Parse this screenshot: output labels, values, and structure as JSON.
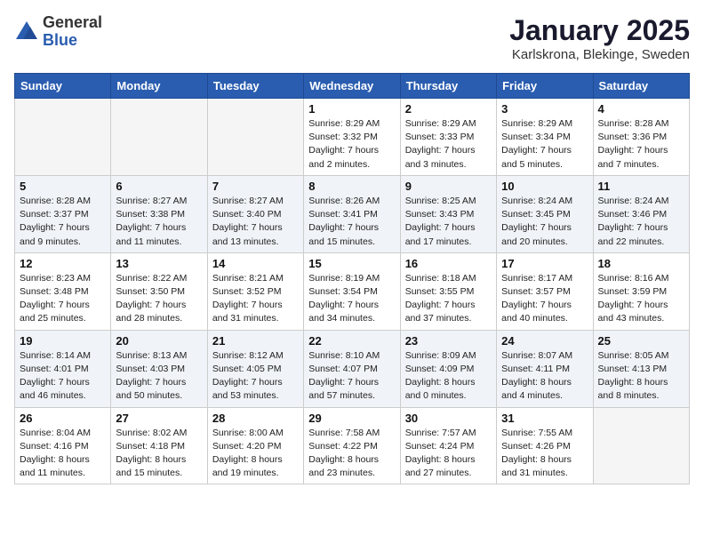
{
  "header": {
    "logo_general": "General",
    "logo_blue": "Blue",
    "title": "January 2025",
    "subtitle": "Karlskrona, Blekinge, Sweden"
  },
  "days_of_week": [
    "Sunday",
    "Monday",
    "Tuesday",
    "Wednesday",
    "Thursday",
    "Friday",
    "Saturday"
  ],
  "weeks": [
    {
      "shaded": false,
      "days": [
        {
          "num": "",
          "sunrise": "",
          "sunset": "",
          "daylight": ""
        },
        {
          "num": "",
          "sunrise": "",
          "sunset": "",
          "daylight": ""
        },
        {
          "num": "",
          "sunrise": "",
          "sunset": "",
          "daylight": ""
        },
        {
          "num": "1",
          "sunrise": "Sunrise: 8:29 AM",
          "sunset": "Sunset: 3:32 PM",
          "daylight": "Daylight: 7 hours and 2 minutes."
        },
        {
          "num": "2",
          "sunrise": "Sunrise: 8:29 AM",
          "sunset": "Sunset: 3:33 PM",
          "daylight": "Daylight: 7 hours and 3 minutes."
        },
        {
          "num": "3",
          "sunrise": "Sunrise: 8:29 AM",
          "sunset": "Sunset: 3:34 PM",
          "daylight": "Daylight: 7 hours and 5 minutes."
        },
        {
          "num": "4",
          "sunrise": "Sunrise: 8:28 AM",
          "sunset": "Sunset: 3:36 PM",
          "daylight": "Daylight: 7 hours and 7 minutes."
        }
      ]
    },
    {
      "shaded": true,
      "days": [
        {
          "num": "5",
          "sunrise": "Sunrise: 8:28 AM",
          "sunset": "Sunset: 3:37 PM",
          "daylight": "Daylight: 7 hours and 9 minutes."
        },
        {
          "num": "6",
          "sunrise": "Sunrise: 8:27 AM",
          "sunset": "Sunset: 3:38 PM",
          "daylight": "Daylight: 7 hours and 11 minutes."
        },
        {
          "num": "7",
          "sunrise": "Sunrise: 8:27 AM",
          "sunset": "Sunset: 3:40 PM",
          "daylight": "Daylight: 7 hours and 13 minutes."
        },
        {
          "num": "8",
          "sunrise": "Sunrise: 8:26 AM",
          "sunset": "Sunset: 3:41 PM",
          "daylight": "Daylight: 7 hours and 15 minutes."
        },
        {
          "num": "9",
          "sunrise": "Sunrise: 8:25 AM",
          "sunset": "Sunset: 3:43 PM",
          "daylight": "Daylight: 7 hours and 17 minutes."
        },
        {
          "num": "10",
          "sunrise": "Sunrise: 8:24 AM",
          "sunset": "Sunset: 3:45 PM",
          "daylight": "Daylight: 7 hours and 20 minutes."
        },
        {
          "num": "11",
          "sunrise": "Sunrise: 8:24 AM",
          "sunset": "Sunset: 3:46 PM",
          "daylight": "Daylight: 7 hours and 22 minutes."
        }
      ]
    },
    {
      "shaded": false,
      "days": [
        {
          "num": "12",
          "sunrise": "Sunrise: 8:23 AM",
          "sunset": "Sunset: 3:48 PM",
          "daylight": "Daylight: 7 hours and 25 minutes."
        },
        {
          "num": "13",
          "sunrise": "Sunrise: 8:22 AM",
          "sunset": "Sunset: 3:50 PM",
          "daylight": "Daylight: 7 hours and 28 minutes."
        },
        {
          "num": "14",
          "sunrise": "Sunrise: 8:21 AM",
          "sunset": "Sunset: 3:52 PM",
          "daylight": "Daylight: 7 hours and 31 minutes."
        },
        {
          "num": "15",
          "sunrise": "Sunrise: 8:19 AM",
          "sunset": "Sunset: 3:54 PM",
          "daylight": "Daylight: 7 hours and 34 minutes."
        },
        {
          "num": "16",
          "sunrise": "Sunrise: 8:18 AM",
          "sunset": "Sunset: 3:55 PM",
          "daylight": "Daylight: 7 hours and 37 minutes."
        },
        {
          "num": "17",
          "sunrise": "Sunrise: 8:17 AM",
          "sunset": "Sunset: 3:57 PM",
          "daylight": "Daylight: 7 hours and 40 minutes."
        },
        {
          "num": "18",
          "sunrise": "Sunrise: 8:16 AM",
          "sunset": "Sunset: 3:59 PM",
          "daylight": "Daylight: 7 hours and 43 minutes."
        }
      ]
    },
    {
      "shaded": true,
      "days": [
        {
          "num": "19",
          "sunrise": "Sunrise: 8:14 AM",
          "sunset": "Sunset: 4:01 PM",
          "daylight": "Daylight: 7 hours and 46 minutes."
        },
        {
          "num": "20",
          "sunrise": "Sunrise: 8:13 AM",
          "sunset": "Sunset: 4:03 PM",
          "daylight": "Daylight: 7 hours and 50 minutes."
        },
        {
          "num": "21",
          "sunrise": "Sunrise: 8:12 AM",
          "sunset": "Sunset: 4:05 PM",
          "daylight": "Daylight: 7 hours and 53 minutes."
        },
        {
          "num": "22",
          "sunrise": "Sunrise: 8:10 AM",
          "sunset": "Sunset: 4:07 PM",
          "daylight": "Daylight: 7 hours and 57 minutes."
        },
        {
          "num": "23",
          "sunrise": "Sunrise: 8:09 AM",
          "sunset": "Sunset: 4:09 PM",
          "daylight": "Daylight: 8 hours and 0 minutes."
        },
        {
          "num": "24",
          "sunrise": "Sunrise: 8:07 AM",
          "sunset": "Sunset: 4:11 PM",
          "daylight": "Daylight: 8 hours and 4 minutes."
        },
        {
          "num": "25",
          "sunrise": "Sunrise: 8:05 AM",
          "sunset": "Sunset: 4:13 PM",
          "daylight": "Daylight: 8 hours and 8 minutes."
        }
      ]
    },
    {
      "shaded": false,
      "days": [
        {
          "num": "26",
          "sunrise": "Sunrise: 8:04 AM",
          "sunset": "Sunset: 4:16 PM",
          "daylight": "Daylight: 8 hours and 11 minutes."
        },
        {
          "num": "27",
          "sunrise": "Sunrise: 8:02 AM",
          "sunset": "Sunset: 4:18 PM",
          "daylight": "Daylight: 8 hours and 15 minutes."
        },
        {
          "num": "28",
          "sunrise": "Sunrise: 8:00 AM",
          "sunset": "Sunset: 4:20 PM",
          "daylight": "Daylight: 8 hours and 19 minutes."
        },
        {
          "num": "29",
          "sunrise": "Sunrise: 7:58 AM",
          "sunset": "Sunset: 4:22 PM",
          "daylight": "Daylight: 8 hours and 23 minutes."
        },
        {
          "num": "30",
          "sunrise": "Sunrise: 7:57 AM",
          "sunset": "Sunset: 4:24 PM",
          "daylight": "Daylight: 8 hours and 27 minutes."
        },
        {
          "num": "31",
          "sunrise": "Sunrise: 7:55 AM",
          "sunset": "Sunset: 4:26 PM",
          "daylight": "Daylight: 8 hours and 31 minutes."
        },
        {
          "num": "",
          "sunrise": "",
          "sunset": "",
          "daylight": ""
        }
      ]
    }
  ]
}
